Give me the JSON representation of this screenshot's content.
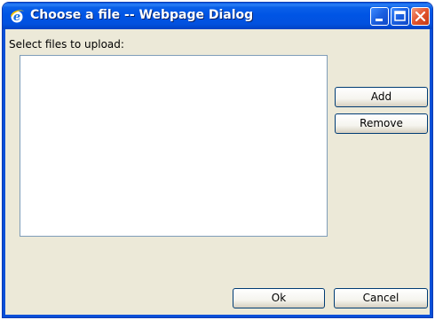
{
  "window": {
    "title": "Choose a file -- Webpage Dialog",
    "title_icon": "ie-icon",
    "controls": [
      "minimize-icon",
      "maximize-icon",
      "close-icon"
    ],
    "title_color": "#0055e5"
  },
  "dialog": {
    "prompt": "Select files to upload:",
    "files": []
  },
  "buttons": {
    "add": "Add",
    "remove": "Remove",
    "ok": "Ok",
    "cancel": "Cancel"
  }
}
